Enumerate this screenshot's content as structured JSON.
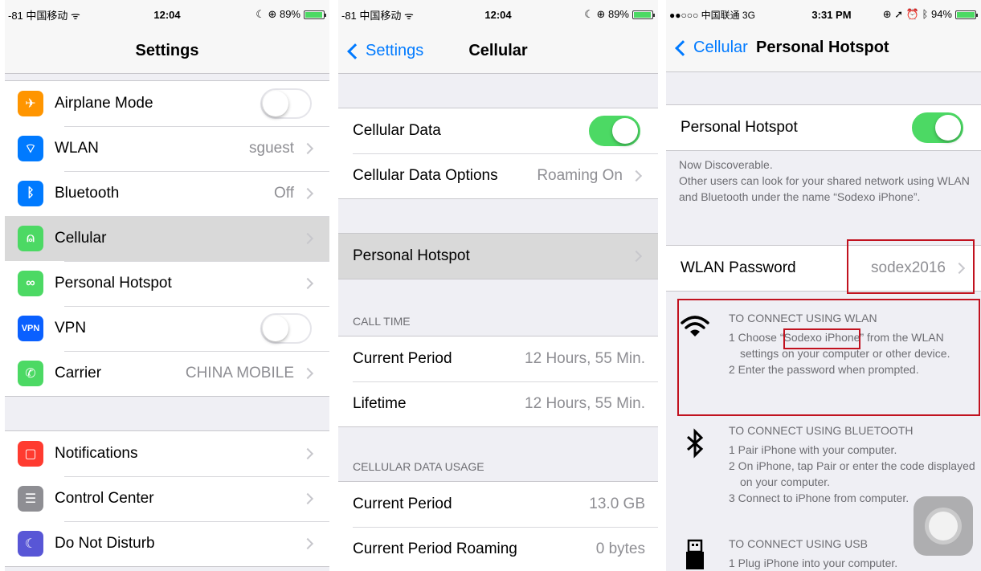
{
  "panel1": {
    "status": {
      "carrier": "-81 中国移动 ᯤ",
      "time": "12:04",
      "right": "☾ ⊕ 89%"
    },
    "nav": {
      "title": "Settings"
    },
    "group1": [
      {
        "label": "Airplane Mode",
        "icon": "airplane-icon",
        "color": "#ff9500",
        "glyph": "✈",
        "toggle": "off"
      },
      {
        "label": "WLAN",
        "value": "sguest",
        "icon": "wifi-icon",
        "color": "#007aff",
        "glyph": "⌔"
      },
      {
        "label": "Bluetooth",
        "value": "Off",
        "icon": "bluetooth-icon",
        "color": "#007aff",
        "glyph": "ᛒ"
      },
      {
        "label": "Cellular",
        "value": "",
        "icon": "antenna-icon",
        "color": "#4cd964",
        "glyph": "⍝",
        "selected": true
      },
      {
        "label": "Personal Hotspot",
        "value": "",
        "icon": "hotspot-icon",
        "color": "#4cd964",
        "glyph": "∞"
      },
      {
        "label": "VPN",
        "icon": "vpn-icon",
        "color": "#0a60ff",
        "glyph": "VPN",
        "toggle": "off"
      },
      {
        "label": "Carrier",
        "value": "CHINA MOBILE",
        "icon": "phone-icon",
        "color": "#4cd964",
        "glyph": "✆"
      }
    ],
    "group2": [
      {
        "label": "Notifications",
        "icon": "notifications-icon",
        "color": "#ff3b30",
        "glyph": "▢"
      },
      {
        "label": "Control Center",
        "icon": "control-center-icon",
        "color": "#8e8e93",
        "glyph": "☰"
      },
      {
        "label": "Do Not Disturb",
        "icon": "moon-icon",
        "color": "#5856d6",
        "glyph": "☾"
      }
    ]
  },
  "panel2": {
    "status": {
      "carrier": "-81 中国移动 ᯤ",
      "time": "12:04",
      "right": "☾ ⊕ 89%"
    },
    "nav": {
      "back": "Settings",
      "title": "Cellular"
    },
    "cellular_data": "Cellular Data",
    "cellular_options": {
      "label": "Cellular Data Options",
      "value": "Roaming On"
    },
    "personal_hotspot": "Personal Hotspot",
    "call_time_header": "CALL TIME",
    "call_time": [
      {
        "label": "Current Period",
        "value": "12 Hours, 55 Min."
      },
      {
        "label": "Lifetime",
        "value": "12 Hours, 55 Min."
      }
    ],
    "usage_header": "CELLULAR DATA USAGE",
    "usage": [
      {
        "label": "Current Period",
        "value": "13.0 GB"
      },
      {
        "label": "Current Period Roaming",
        "value": "0 bytes"
      }
    ]
  },
  "panel3": {
    "status": {
      "carrier": "●●○○○ 中国联通 3G",
      "time": "3:31 PM",
      "right": "⊕ ➚ ⏰ ᛒ 94%"
    },
    "nav": {
      "back": "Cellular",
      "title": "Personal Hotspot"
    },
    "hotspot_label": "Personal Hotspot",
    "discoverable": "Now Discoverable.",
    "description": "Other users can look for your shared network using WLAN and Bluetooth under the name “Sodexo iPhone”.",
    "password": {
      "label": "WLAN Password",
      "value": "sodex2016"
    },
    "wlan": {
      "title": "TO CONNECT USING WLAN",
      "step1_prefix": "1 Choose ",
      "step1_name": "“Sodexo iPhone”",
      "step1_suffix": " from the WLAN settings on your computer or other device.",
      "step2": "2 Enter the password when prompted."
    },
    "bluetooth": {
      "title": "TO CONNECT USING BLUETOOTH",
      "step1": "1 Pair iPhone with your computer.",
      "step2": "2 On iPhone, tap Pair or enter the code displayed on your computer.",
      "step3": "3 Connect to iPhone from computer."
    },
    "usb": {
      "title": "TO CONNECT USING USB",
      "step1": "1 Plug iPhone into your computer."
    }
  }
}
